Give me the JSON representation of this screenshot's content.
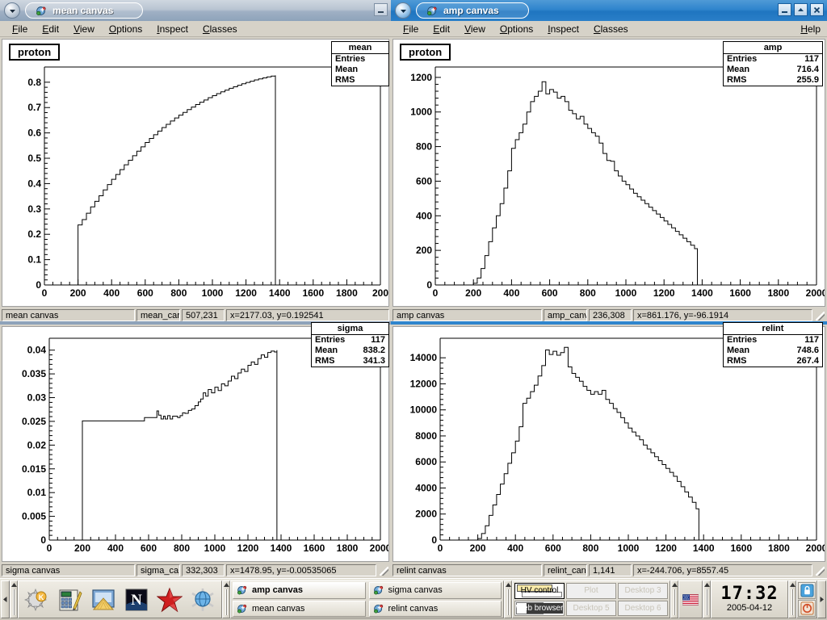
{
  "desktop": {
    "background_color": "#5a768f"
  },
  "windows": [
    {
      "id": "mean-canvas",
      "title": "mean canvas",
      "active": false,
      "menus": [
        "File",
        "Edit",
        "View",
        "Options",
        "Inspect",
        "Classes"
      ],
      "help_label": "",
      "buttons": {
        "minimize": "_",
        "maximize": "",
        "close": ""
      },
      "plot_title": "proton",
      "stats": {
        "title": "mean",
        "entries_label": "Entries",
        "entries": "",
        "mean_label": "Mean",
        "mean": "",
        "rms_label": "RMS",
        "rms": ""
      },
      "status": {
        "name": "mean canvas",
        "object": "mean_car",
        "pixel": "507,231",
        "coords": "x=2177.03, y=0.192541"
      }
    },
    {
      "id": "amp-canvas",
      "title": "amp canvas",
      "active": true,
      "menus": [
        "File",
        "Edit",
        "View",
        "Options",
        "Inspect",
        "Classes"
      ],
      "help_label": "Help",
      "buttons": {
        "minimize": "_",
        "maximize": "^",
        "close": "x"
      },
      "plot_title": "proton",
      "stats": {
        "title": "amp",
        "entries_label": "Entries",
        "entries": "117",
        "mean_label": "Mean",
        "mean": "716.4",
        "rms_label": "RMS",
        "rms": "255.9"
      },
      "status": {
        "name": "amp canvas",
        "object": "amp_canv",
        "pixel": "236,308",
        "coords": "x=861.176, y=-96.1914"
      }
    },
    {
      "id": "sigma-canvas",
      "title": "sigma canvas",
      "active": false,
      "menus": [],
      "help_label": "",
      "buttons": {},
      "plot_title": "",
      "stats": {
        "title": "sigma",
        "entries_label": "Entries",
        "entries": "117",
        "mean_label": "Mean",
        "mean": "838.2",
        "rms_label": "RMS",
        "rms": "341.3"
      },
      "status": {
        "name": "sigma canvas",
        "object": "sigma_ca",
        "pixel": "332,303",
        "coords": "x=1478.95, y=-0.00535065"
      }
    },
    {
      "id": "relint-canvas",
      "title": "relint canvas",
      "active": false,
      "menus": [],
      "help_label": "",
      "buttons": {},
      "plot_title": "",
      "stats": {
        "title": "relint",
        "entries_label": "Entries",
        "entries": "117",
        "mean_label": "Mean",
        "mean": "748.6",
        "rms_label": "RMS",
        "rms": "267.4"
      },
      "status": {
        "name": "relint canvas",
        "object": "relint_can",
        "pixel": "1,141",
        "coords": "x=-244.706, y=8557.45"
      }
    }
  ],
  "chart_data": [
    {
      "id": "mean-canvas-plot",
      "type": "line",
      "title": "proton",
      "xlabel": "",
      "ylabel": "",
      "xlim": [
        0,
        2000
      ],
      "ylim": [
        0,
        0.86
      ],
      "xticks": [
        0,
        200,
        400,
        600,
        800,
        1000,
        1200,
        1400,
        1600,
        1800,
        2000
      ],
      "xticklabels": [
        "0",
        "200",
        "400",
        "600",
        "800",
        "1000",
        "1200",
        "1400",
        "1600",
        "1800",
        "200"
      ],
      "yticks": [
        0,
        0.1,
        0.2,
        0.3,
        0.4,
        0.5,
        0.6,
        0.7,
        0.8
      ],
      "yticklabels": [
        "0",
        "0.1",
        "0.2",
        "0.3",
        "0.4",
        "0.5",
        "0.6",
        "0.7",
        "0.8"
      ],
      "grid": false,
      "legend": "none",
      "x": [
        200,
        225,
        250,
        275,
        300,
        325,
        350,
        375,
        400,
        425,
        450,
        475,
        500,
        525,
        550,
        575,
        600,
        625,
        650,
        675,
        700,
        725,
        750,
        775,
        800,
        825,
        850,
        875,
        900,
        925,
        950,
        975,
        1000,
        1025,
        1050,
        1075,
        1100,
        1125,
        1150,
        1175,
        1200,
        1225,
        1250,
        1275,
        1300,
        1325,
        1350,
        1375
      ],
      "values": [
        0.237,
        0.258,
        0.283,
        0.308,
        0.33,
        0.352,
        0.375,
        0.396,
        0.417,
        0.436,
        0.455,
        0.474,
        0.492,
        0.51,
        0.528,
        0.545,
        0.562,
        0.578,
        0.593,
        0.607,
        0.621,
        0.634,
        0.647,
        0.659,
        0.67,
        0.681,
        0.692,
        0.702,
        0.712,
        0.721,
        0.73,
        0.739,
        0.747,
        0.755,
        0.762,
        0.769,
        0.776,
        0.782,
        0.788,
        0.794,
        0.799,
        0.804,
        0.809,
        0.813,
        0.817,
        0.821,
        0.824,
        0.827
      ]
    },
    {
      "id": "amp-canvas-plot",
      "type": "line",
      "title": "proton",
      "xlabel": "",
      "ylabel": "",
      "xlim": [
        0,
        2000
      ],
      "ylim": [
        0,
        1260
      ],
      "xticks": [
        0,
        200,
        400,
        600,
        800,
        1000,
        1200,
        1400,
        1600,
        1800,
        2000
      ],
      "xticklabels": [
        "0",
        "200",
        "400",
        "600",
        "800",
        "1000",
        "1200",
        "1400",
        "1600",
        "1800",
        "2000"
      ],
      "yticks": [
        0,
        200,
        400,
        600,
        800,
        1000,
        1200
      ],
      "yticklabels": [
        "0",
        "200",
        "400",
        "600",
        "800",
        "1000",
        "1200"
      ],
      "grid": false,
      "legend": "none",
      "x": [
        200,
        220,
        240,
        260,
        280,
        300,
        320,
        340,
        360,
        380,
        400,
        420,
        440,
        460,
        480,
        500,
        520,
        540,
        560,
        580,
        600,
        620,
        640,
        660,
        680,
        700,
        720,
        740,
        760,
        780,
        800,
        820,
        840,
        860,
        880,
        900,
        920,
        940,
        960,
        980,
        1000,
        1020,
        1040,
        1060,
        1080,
        1100,
        1120,
        1140,
        1160,
        1180,
        1200,
        1220,
        1240,
        1260,
        1280,
        1300,
        1320,
        1340,
        1360,
        1375
      ],
      "values": [
        10,
        40,
        95,
        170,
        250,
        330,
        400,
        470,
        560,
        660,
        790,
        840,
        880,
        930,
        1000,
        1060,
        1090,
        1120,
        1175,
        1105,
        1130,
        1115,
        1080,
        1090,
        1060,
        1010,
        990,
        960,
        975,
        930,
        905,
        880,
        860,
        820,
        760,
        720,
        715,
        660,
        630,
        600,
        580,
        555,
        530,
        510,
        490,
        470,
        450,
        430,
        410,
        390,
        370,
        350,
        330,
        310,
        290,
        270,
        250,
        230,
        210,
        0
      ]
    },
    {
      "id": "sigma-canvas-plot",
      "type": "line",
      "title": "",
      "xlabel": "",
      "ylabel": "",
      "xlim": [
        0,
        2000
      ],
      "ylim": [
        0,
        0.0425
      ],
      "xticks": [
        0,
        200,
        400,
        600,
        800,
        1000,
        1200,
        1400,
        1600,
        1800,
        2000
      ],
      "xticklabels": [
        "0",
        "200",
        "400",
        "600",
        "800",
        "1000",
        "1200",
        "1400",
        "1600",
        "1800",
        "2000"
      ],
      "yticks": [
        0,
        0.005,
        0.01,
        0.015,
        0.02,
        0.025,
        0.03,
        0.035,
        0.04
      ],
      "yticklabels": [
        "0",
        "0.005",
        "0.01",
        "0.015",
        "0.02",
        "0.025",
        "0.03",
        "0.035",
        "0.04"
      ],
      "grid": false,
      "legend": "none",
      "x": [
        200,
        250,
        300,
        350,
        400,
        450,
        500,
        550,
        575,
        600,
        625,
        650,
        660,
        675,
        690,
        700,
        715,
        730,
        745,
        760,
        775,
        790,
        805,
        820,
        840,
        860,
        880,
        900,
        915,
        930,
        945,
        960,
        980,
        1000,
        1020,
        1040,
        1060,
        1080,
        1100,
        1120,
        1140,
        1160,
        1180,
        1200,
        1220,
        1240,
        1260,
        1280,
        1300,
        1320,
        1340,
        1360,
        1375
      ],
      "values": [
        0.0251,
        0.0251,
        0.0251,
        0.0251,
        0.0251,
        0.0251,
        0.0251,
        0.0251,
        0.0258,
        0.0258,
        0.0258,
        0.0272,
        0.0263,
        0.0255,
        0.0261,
        0.0255,
        0.0262,
        0.0255,
        0.0261,
        0.0261,
        0.0258,
        0.0262,
        0.0268,
        0.0267,
        0.0273,
        0.0276,
        0.0283,
        0.0291,
        0.0297,
        0.031,
        0.0303,
        0.0317,
        0.031,
        0.0322,
        0.0315,
        0.0329,
        0.0325,
        0.0335,
        0.0345,
        0.034,
        0.0352,
        0.036,
        0.0355,
        0.0368,
        0.0375,
        0.037,
        0.0382,
        0.039,
        0.0385,
        0.0395,
        0.0398,
        0.0396,
        0.04
      ]
    },
    {
      "id": "relint-canvas-plot",
      "type": "line",
      "title": "",
      "xlabel": "",
      "ylabel": "",
      "xlim": [
        0,
        2000
      ],
      "ylim": [
        0,
        15500
      ],
      "xticks": [
        0,
        200,
        400,
        600,
        800,
        1000,
        1200,
        1400,
        1600,
        1800,
        2000
      ],
      "xticklabels": [
        "0",
        "200",
        "400",
        "600",
        "800",
        "1000",
        "1200",
        "1400",
        "1600",
        "1800",
        "2000"
      ],
      "yticks": [
        0,
        2000,
        4000,
        6000,
        8000,
        10000,
        12000,
        14000
      ],
      "yticklabels": [
        "0",
        "2000",
        "4000",
        "6000",
        "8000",
        "10000",
        "12000",
        "14000"
      ],
      "grid": false,
      "legend": "none",
      "x": [
        200,
        220,
        240,
        260,
        280,
        300,
        320,
        340,
        360,
        380,
        400,
        420,
        440,
        460,
        480,
        500,
        520,
        540,
        560,
        580,
        600,
        620,
        640,
        660,
        680,
        700,
        720,
        740,
        760,
        780,
        800,
        820,
        840,
        860,
        880,
        900,
        920,
        940,
        960,
        980,
        1000,
        1020,
        1040,
        1060,
        1080,
        1100,
        1120,
        1140,
        1160,
        1180,
        1200,
        1220,
        1240,
        1260,
        1280,
        1300,
        1320,
        1340,
        1360,
        1375
      ],
      "values": [
        120,
        500,
        1100,
        1900,
        2700,
        3500,
        4300,
        5100,
        5900,
        6700,
        7600,
        8700,
        10500,
        10900,
        11400,
        11900,
        12600,
        13400,
        14600,
        14250,
        14500,
        14200,
        14400,
        14800,
        13300,
        12800,
        12500,
        12200,
        11800,
        11500,
        11200,
        11400,
        11200,
        11500,
        10800,
        10500,
        10100,
        9800,
        9400,
        9000,
        8600,
        8300,
        8000,
        7700,
        7300,
        7000,
        6700,
        6400,
        6100,
        5800,
        5500,
        5200,
        4900,
        4500,
        4100,
        3700,
        3300,
        2900,
        2400,
        0
      ]
    }
  ],
  "taskbar": {
    "launcher_icons": [
      "kmenu-icon",
      "calculator-icon",
      "image-viewer-icon",
      "netscape-icon",
      "star-icon",
      "web-browser-icon"
    ],
    "tasks": [
      {
        "label": "amp canvas",
        "active": true,
        "icon": "root-canvas-icon"
      },
      {
        "label": "sigma canvas",
        "active": false,
        "icon": "root-canvas-icon"
      },
      {
        "label": "mean canvas",
        "active": false,
        "icon": "root-canvas-icon"
      },
      {
        "label": "relint canvas",
        "active": false,
        "icon": "root-canvas-icon"
      }
    ],
    "desktops": [
      {
        "label": "HV control",
        "current": true
      },
      {
        "label": "Plot",
        "current": false
      },
      {
        "label": "Desktop 3",
        "current": false
      },
      {
        "label": "Web browser",
        "current": false
      },
      {
        "label": "Desktop 5",
        "current": false
      },
      {
        "label": "Desktop 6",
        "current": false
      }
    ],
    "tray_icon": "us-flag-icon",
    "clock_time": "17:32",
    "clock_date": "2005-04-12",
    "system_buttons": [
      "lock-screen-icon",
      "logout-icon"
    ],
    "overflow_arrow": "▶",
    "collapse_arrow": "◀"
  }
}
